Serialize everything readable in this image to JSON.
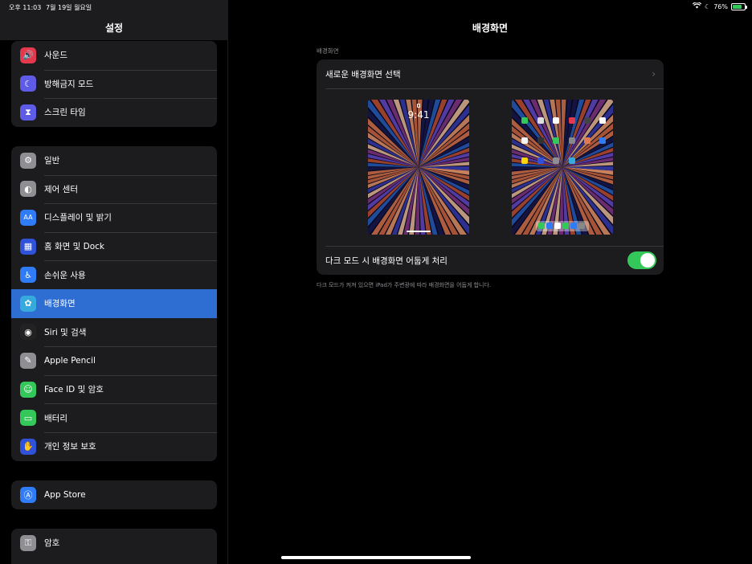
{
  "status_bar": {
    "time": "오후 11:03",
    "date": "7월 19일 월요일",
    "battery": "76%",
    "battery_level": 0.76
  },
  "sidebar": {
    "title": "설정",
    "group1": [
      {
        "label": "사운드",
        "icon": "speaker-icon",
        "color": "#e3394f"
      },
      {
        "label": "방해금지 모드",
        "icon": "moon-icon",
        "color": "#5e5ce6"
      },
      {
        "label": "스크린 타임",
        "icon": "hourglass-icon",
        "color": "#5e5ce6"
      }
    ],
    "group2": [
      {
        "label": "일반",
        "icon": "gear-icon",
        "color": "#8e8e93"
      },
      {
        "label": "제어 센터",
        "icon": "toggles-icon",
        "color": "#8e8e93"
      },
      {
        "label": "디스플레이 및 밝기",
        "icon": "text-size-icon",
        "color": "#2f7cf6"
      },
      {
        "label": "홈 화면 및 Dock",
        "icon": "grid-icon",
        "color": "#2f52d9"
      },
      {
        "label": "손쉬운 사용",
        "icon": "accessibility-icon",
        "color": "#2f7cf6"
      },
      {
        "label": "배경화면",
        "icon": "flower-icon",
        "color": "#36aadc"
      },
      {
        "label": "Siri 및 검색",
        "icon": "siri-icon",
        "color": "#222"
      },
      {
        "label": "Apple Pencil",
        "icon": "pencil-icon",
        "color": "#8e8e93"
      },
      {
        "label": "Face ID 및 암호",
        "icon": "face-id-icon",
        "color": "#34c759"
      },
      {
        "label": "배터리",
        "icon": "battery-icon",
        "color": "#34c759"
      },
      {
        "label": "개인 정보 보호",
        "icon": "hand-icon",
        "color": "#2f52d9"
      }
    ],
    "group3": [
      {
        "label": "App Store",
        "icon": "app-store-icon",
        "color": "#2f7cf6"
      }
    ],
    "group4": [
      {
        "label": "암호",
        "icon": "key-icon",
        "color": "#8e8e93"
      }
    ]
  },
  "main": {
    "title": "배경화면",
    "section_label": "배경화면",
    "choose_label": "새로운 배경화면 선택",
    "lock_time": "9:41",
    "dark_label": "다크 모드 시 배경화면 어둡게 처리",
    "dark_enabled": true,
    "footnote": "다크 모드가 켜져 있으면 iPad가 주변광에 따라 배경화면을 어둡게 합니다."
  },
  "colors": {
    "accent": "#2e6dd1",
    "toggle_on": "#34c759",
    "card": "#1c1c1e"
  }
}
